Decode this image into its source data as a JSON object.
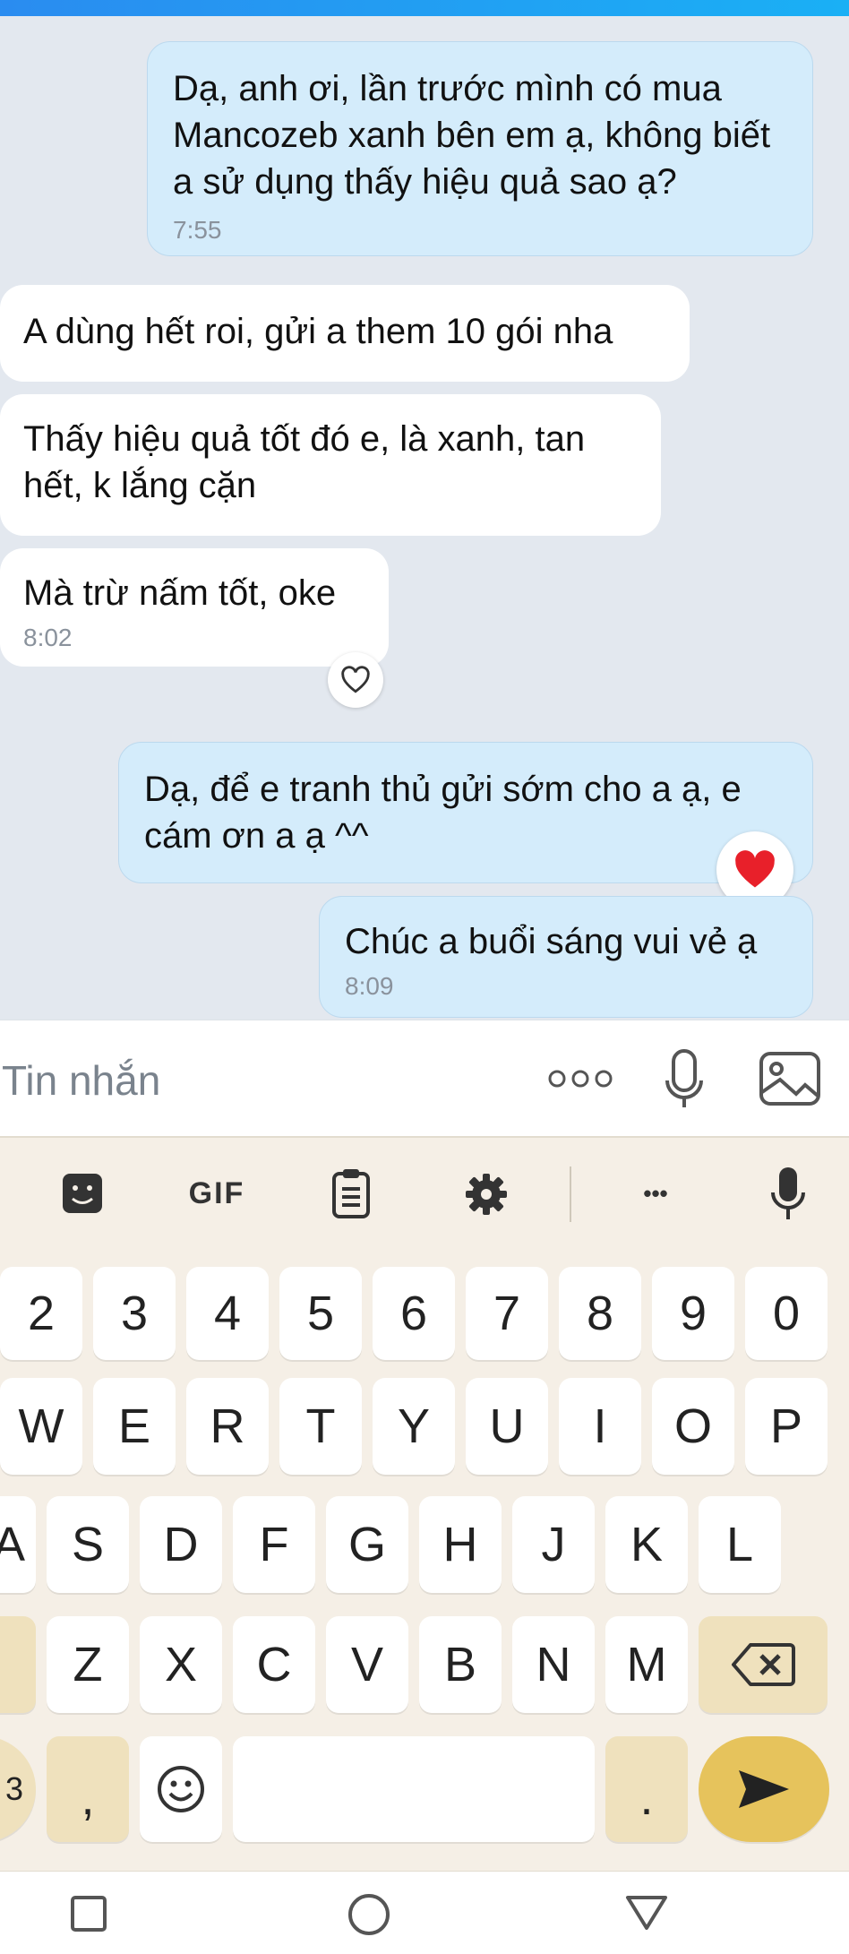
{
  "chat": {
    "messages": [
      {
        "text": "Dạ, anh ơi, lần trước mình có mua Mancozeb xanh bên em ạ, không biết a sử dụng thấy hiệu quả sao ạ?",
        "time": "7:55",
        "direction": "outgoing"
      },
      {
        "text": "A dùng hết roi, gửi a them 10 gói nha",
        "direction": "incoming"
      },
      {
        "text": "Thấy hiệu quả tốt đó e, là xanh, tan hết, k lắng cặn",
        "direction": "incoming"
      },
      {
        "text": "Mà trừ nấm tốt, oke",
        "time": "8:02",
        "direction": "incoming"
      },
      {
        "text": "Dạ, để e tranh thủ gửi sớm cho a ạ, e cám ơn a ạ ^^",
        "direction": "outgoing",
        "reaction": "heart"
      },
      {
        "text": "Chúc a buổi sáng vui vẻ ạ",
        "time": "8:09",
        "direction": "outgoing"
      }
    ]
  },
  "composer": {
    "placeholder": "Tin nhắn",
    "icons": [
      "more-dots-icon",
      "microphone-icon",
      "image-icon"
    ]
  },
  "keyboard": {
    "toolbar": {
      "gif_label": "GIF",
      "more_label": "•••"
    },
    "row_numbers": [
      "2",
      "3",
      "4",
      "5",
      "6",
      "7",
      "8",
      "9",
      "0"
    ],
    "row_top": [
      "W",
      "E",
      "R",
      "T",
      "Y",
      "U",
      "I",
      "O",
      "P"
    ],
    "row_home": [
      "A",
      "S",
      "D",
      "F",
      "G",
      "H",
      "J",
      "K",
      "L"
    ],
    "row_bottom": [
      "Z",
      "X",
      "C",
      "V",
      "B",
      "N",
      "M"
    ],
    "left_partial_label": "3",
    "comma": ",",
    "period": "."
  },
  "colors": {
    "accent": "#2a8cf0",
    "outgoing_bubble": "#d4ecfb",
    "send_key": "#e6c35c",
    "heart": "#e8202a"
  }
}
